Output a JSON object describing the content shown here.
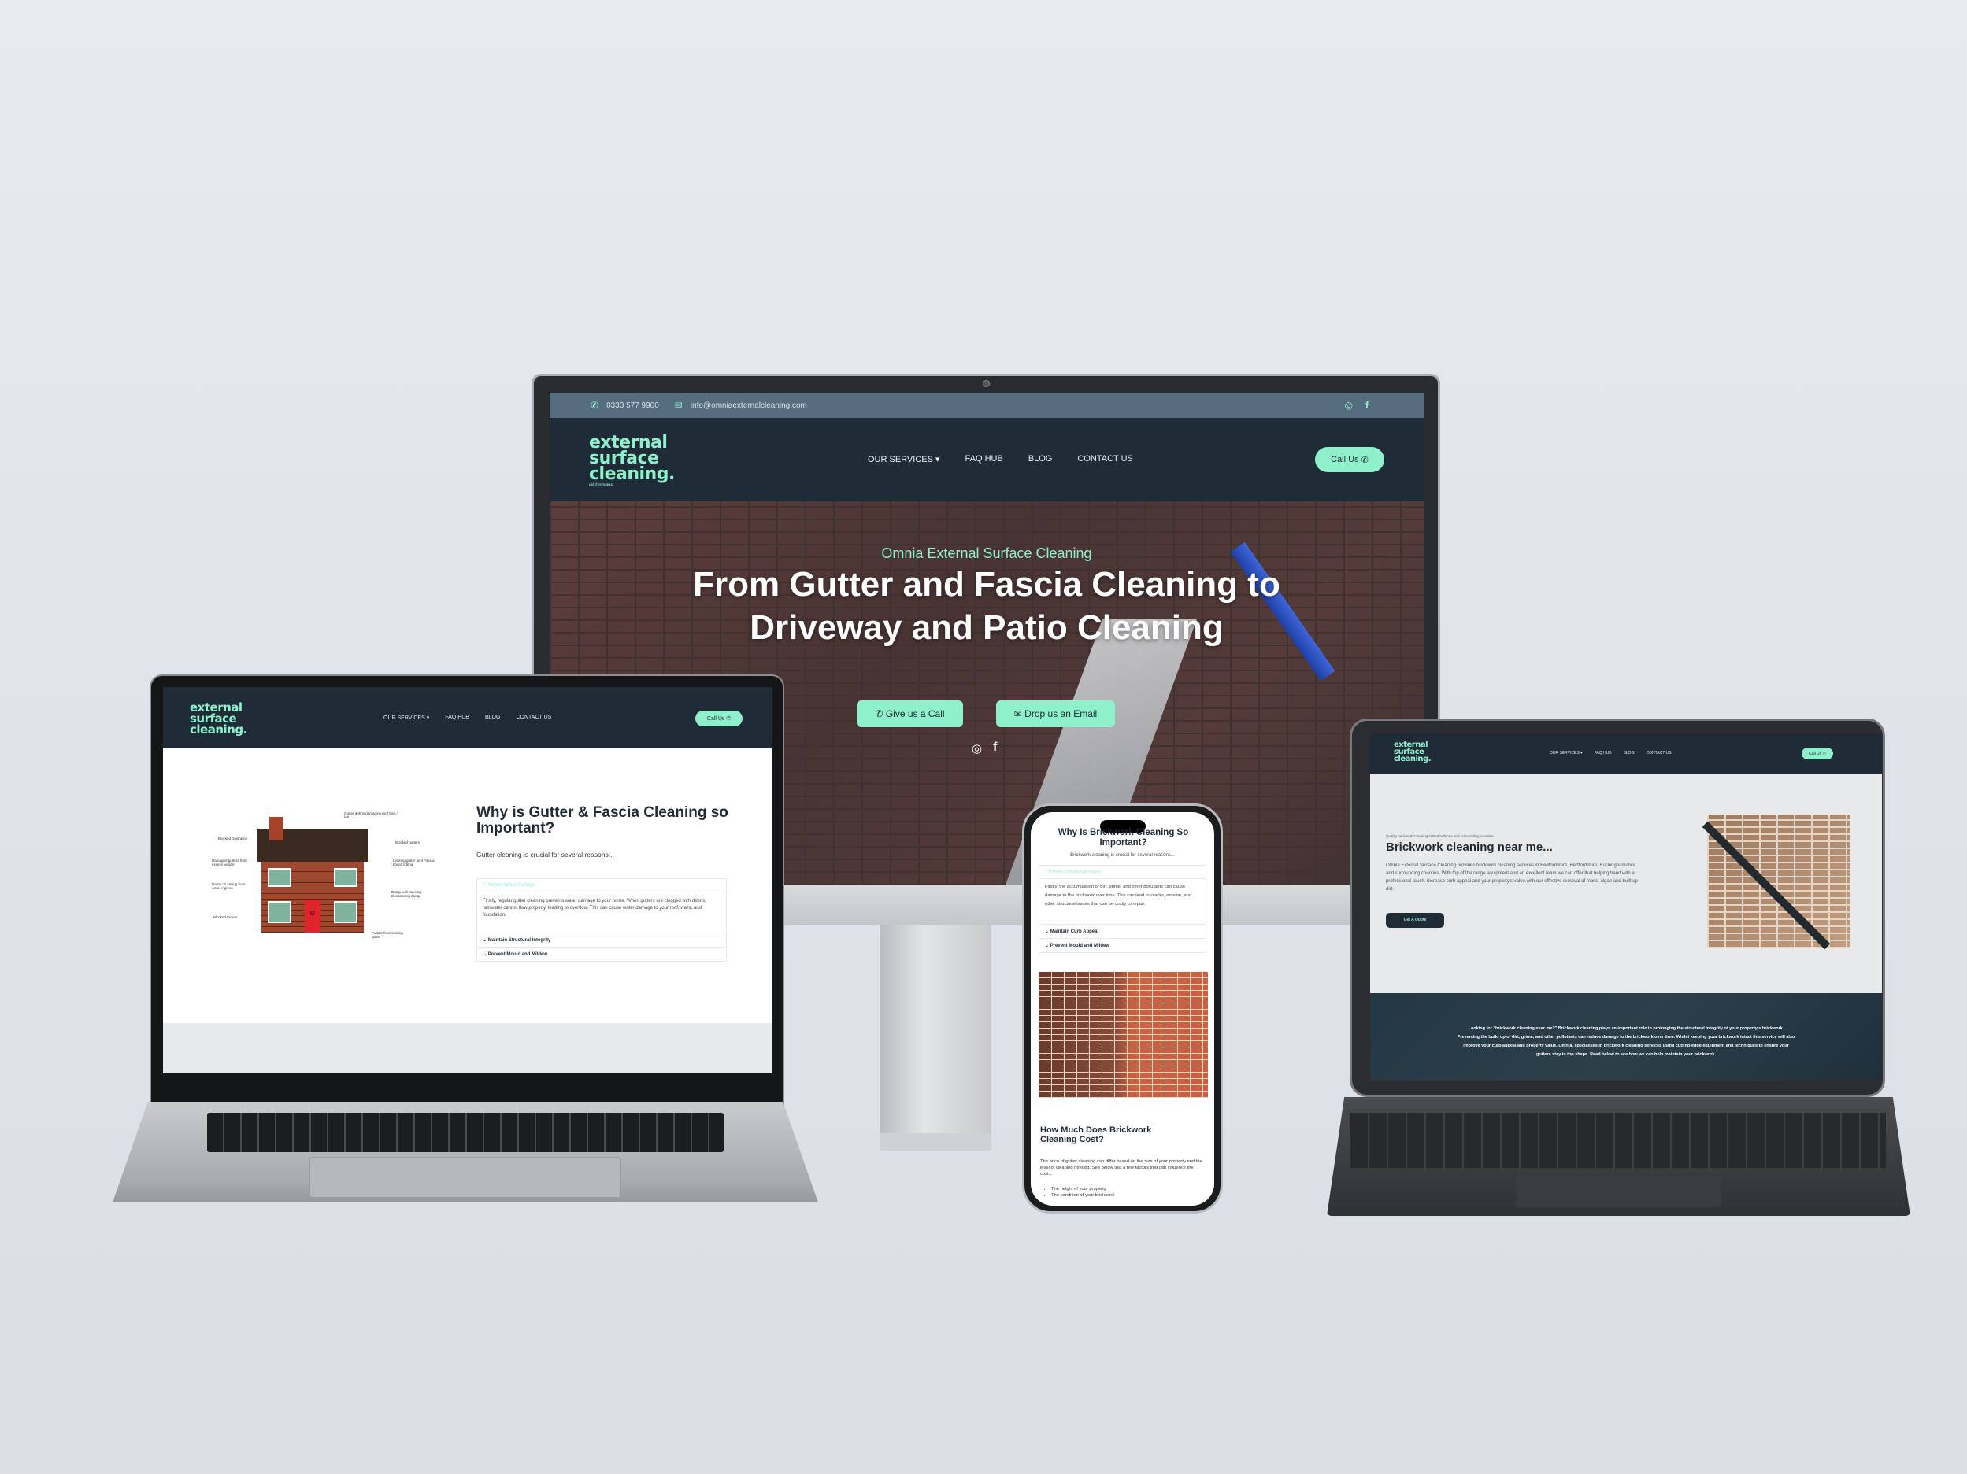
{
  "brand": {
    "logo_lines": [
      "external",
      "surface",
      "cleaning."
    ],
    "logo_tagline": "part of omnia group",
    "accent": "#8ff0cc",
    "dark": "#1f2b37",
    "topbar": "#566d80"
  },
  "nav": {
    "items": [
      "OUR SERVICES",
      "FAQ HUB",
      "BLOG",
      "CONTACT US"
    ],
    "call_button": "Call Us"
  },
  "desktop": {
    "topbar": {
      "phone": "0333 577 9900",
      "email": "info@omniaexternalcleaning.com"
    },
    "hero": {
      "eyebrow": "Omnia External Surface Cleaning",
      "title_line1": "From Gutter and Fascia Cleaning to",
      "title_line2": "Driveway and Patio Cleaning",
      "button_call": "Give us a Call",
      "button_email": "Drop us an Email"
    }
  },
  "laptop": {
    "heading": "Why is Gutter & Fascia Cleaning so Important?",
    "intro": "Gutter cleaning is crucial for several reasons...",
    "accordion": [
      {
        "title": "Prevent Water Damage",
        "open": true,
        "body": "Firstly, regular gutter cleaning prevents water damage to your home. When gutters are clogged with debris, rainwater cannot flow properly, leading to overflow. This can cause water damage to your roof, walls, and foundation."
      },
      {
        "title": "Maintain Structural Integrity",
        "open": false
      },
      {
        "title": "Prevent Mould and Mildew",
        "open": false
      }
    ],
    "diagram_labels": [
      "Gutter debris damaging roof tiles / felt",
      "Blocked Downpipe",
      "Blocked gutters",
      "Damaged gutters from excess weight",
      "Leaking gutter joint Fascia board rotting",
      "Damp on ceiling from water ingress",
      "Damp wall causing Devastating damp",
      "Blocked Drains",
      "Puddle from leaking gutter"
    ],
    "door_number": "67"
  },
  "phone": {
    "heading": "Why Is Brickwork Cleaning So Important?",
    "intro": "Brickwork cleaning is crucial for several reasons...",
    "accordion": [
      {
        "title": "Prevent Structural Issues",
        "open": true,
        "body": "Firstly, the accumulation of dirt, grime, and other pollutants can cause damage to the brickwork over time. This can lead to cracks, erosion, and other structural issues that can be costly to repair."
      },
      {
        "title": "Maintain Curb Appeal",
        "open": false
      },
      {
        "title": "Prevent Mould and Mildew",
        "open": false
      }
    ],
    "cost_heading": "How Much Does Brickwork Cleaning Cost?",
    "cost_text": "The price of gutter cleaning can differ based on the size of your property and the level of cleaning needed. See below just a few factors that can influence the cost...",
    "factors": [
      "The height of your property",
      "The condition of your brickwork"
    ]
  },
  "tablet": {
    "eyebrow": "Quality brickwork Cleaning in Bedfordshire and surrounding counties",
    "heading": "Brickwork cleaning near me...",
    "body": "Omnia External Surface Cleaning provides brickwork cleaning services in Bedfordshire, Hertfordshire, Buckinghamshire and surrounding counties. With top of the range equipment and an excellent team we can offer that helping hand with a professional touch. Increase curb appeal and your property's value with our effective removal of moss, algae and built up dirt.",
    "quote_button": "Get A Quote",
    "band_text": "Looking for \"brickwork cleaning near me?\" Brickwork cleaning plays an important role in prolonging the structural integrity of your property's brickwork. Preventing the build up of dirt, grime, and other pollutants can reduce damage to the brickwork over time. Whilst keeping your brickwork intact this service will also improve your curb appeal and property value. Omnia, specialises in brickwork cleaning services using cutting-edge equipment and techniques to ensure your gutters stay in top shape. Read below to see how we can help maintain your brickwork."
  }
}
